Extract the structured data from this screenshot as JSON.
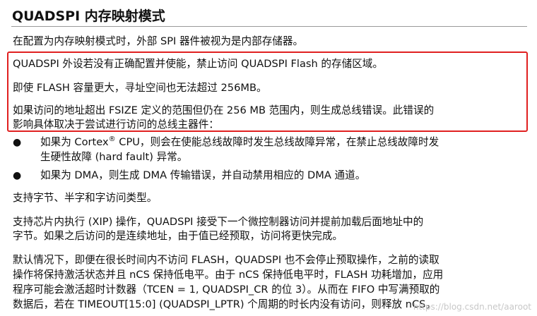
{
  "heading": "QUADSPI 内存映射模式",
  "intro": "在配置为内存映射模式时，外部 SPI 器件被视为是内部存储器。",
  "box": {
    "line1": "QUADSPI 外设若没有正确配置并使能，禁止访问 QUADSPI Flash 的存储区域。",
    "line2": "即使 FLASH 容量更大，寻址空间也无法超过 256MB。",
    "line3a": "如果访问的地址超出 FSIZE 定义的范围但仍在 256 MB 范围内，则生成总线错误。此错误的",
    "line3b": "影响具体取决于尝试进行访问的总线主器件："
  },
  "bullets": [
    {
      "marker": "●",
      "line1_pre": "如果为 Cortex",
      "line1_sup": "®",
      "line1_post": " CPU，则会在使能总线故障时发生总线故障异常，在禁止总线故障时发",
      "line2": "生硬性故障 (hard fault) 异常。"
    },
    {
      "marker": "●",
      "line1": "如果为 DMA，则生成 DMA 传输错误，并自动禁用相应的 DMA 通道。"
    }
  ],
  "para_access": "支持字节、半字和字访问类型。",
  "para_xip": {
    "line1": "支持芯片内执行 (XIP) 操作，QUADSPI 接受下一个微控制器访问并提前加载后面地址中的",
    "line2": "字节。如果之后访问的是连续地址，由于值已经预取，访问将更快完成。"
  },
  "para_default": {
    "line1": "默认情况下，即便在很长时间内不访问 FLASH，QUADSPI 也不会停止预取操作，之前的读取",
    "line2": "操作将保持激活状态并且 nCS 保持低电平。由于 nCS 保持低电平时，FLASH 功耗增加，应用",
    "line3": "程序可能会激活超时计数器（TCEN = 1, QUADSPI_CR 的位 3）。从而在 FIFO 中写满预取的",
    "line4": "数据后，若在 TIMEOUT[15:0] (QUADSPI_LPTR) 个周期的时长内没有访问，则释放 nCS。"
  },
  "watermark": "https://blog.csdn.net/aaroot"
}
